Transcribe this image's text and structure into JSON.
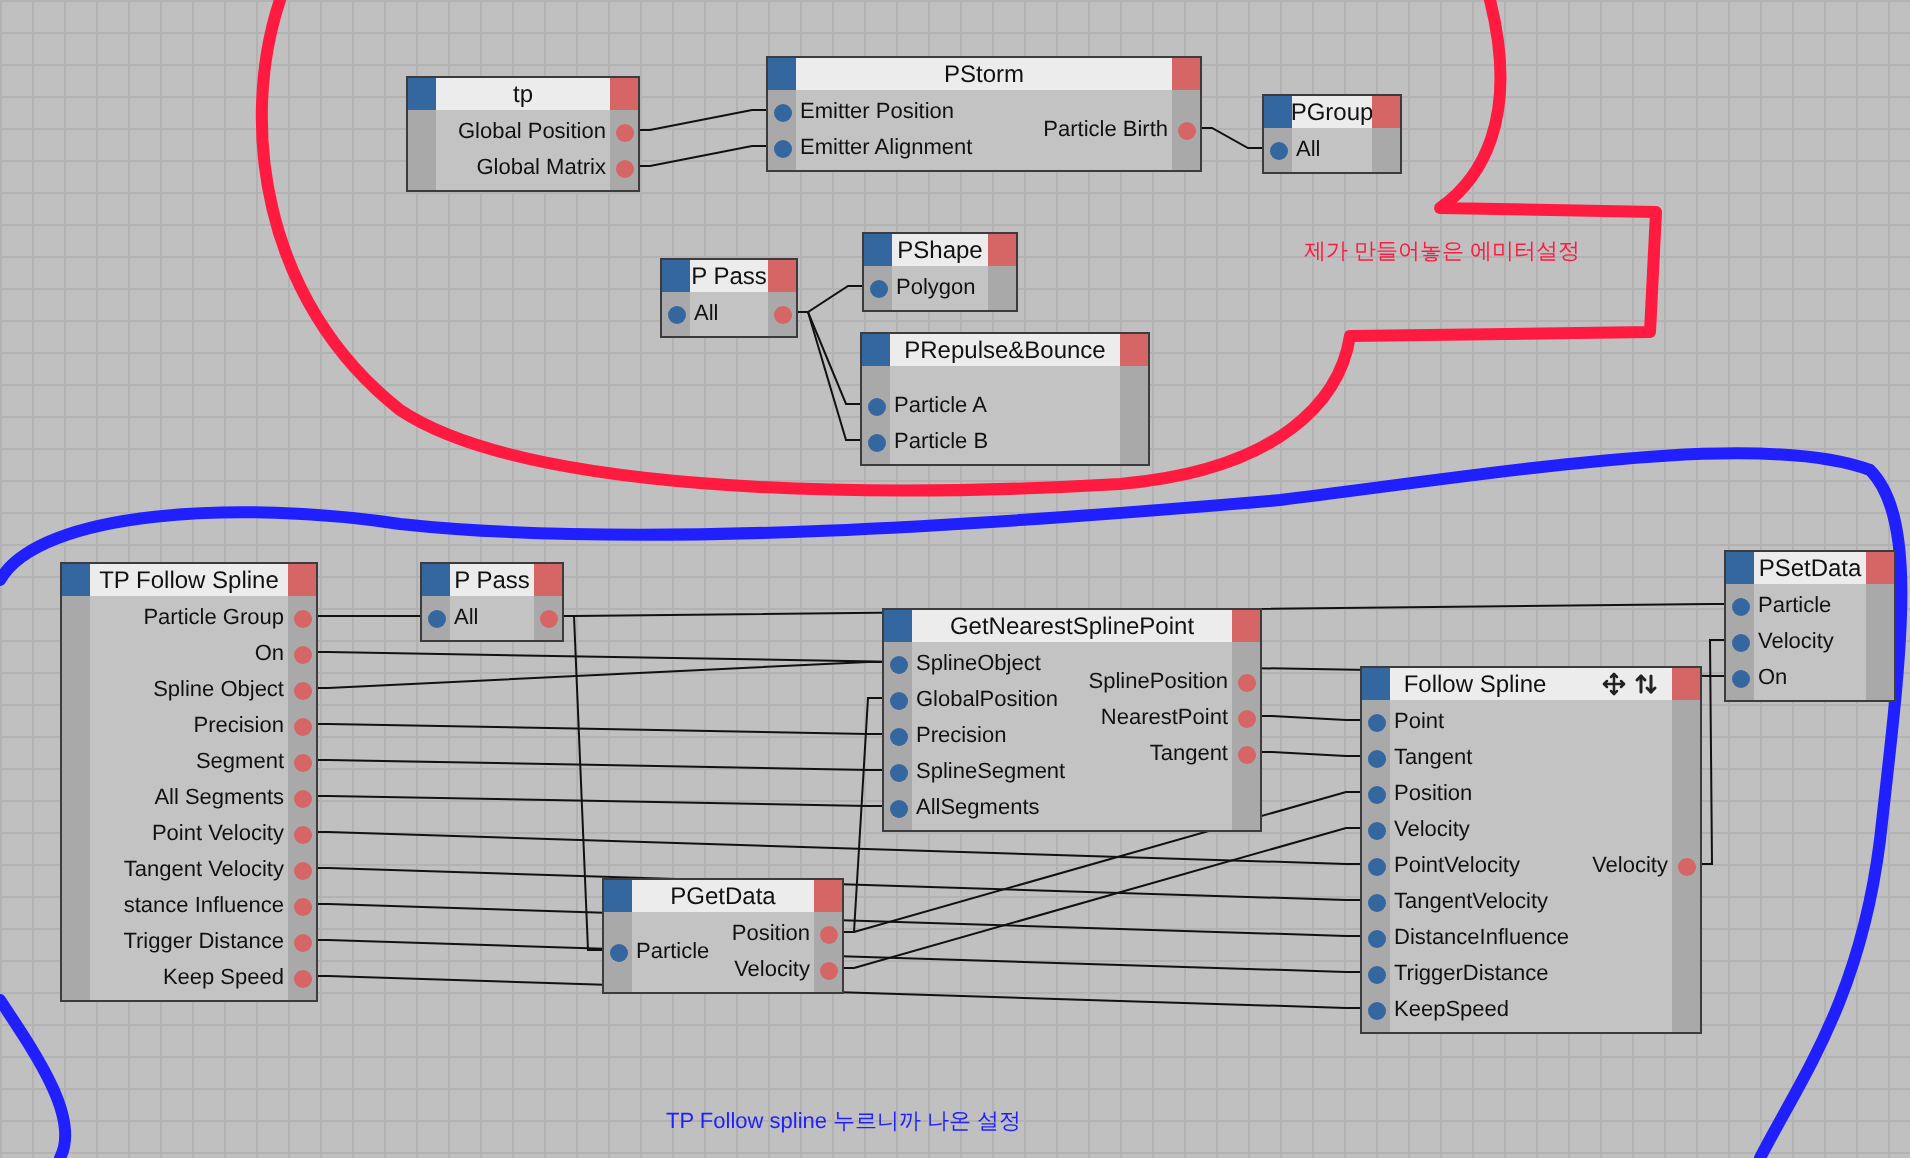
{
  "nodes": [
    {
      "title": "tp",
      "outputs": [
        "Global Position",
        "Global Matrix"
      ]
    },
    {
      "title": "PStorm",
      "inputs": [
        "Emitter Position",
        "Emitter Alignment"
      ],
      "outputs": [
        "Particle Birth"
      ]
    },
    {
      "title": "PGroup",
      "inputs": [
        "All"
      ],
      "passthrough": false
    },
    {
      "title": "P Pass",
      "inputs": [
        "All"
      ],
      "passthrough": true
    },
    {
      "title": "PShape",
      "inputs": [
        "Polygon"
      ]
    },
    {
      "title": "PRepulse&Bounce",
      "inputs": [
        "Particle A",
        "Particle B"
      ]
    },
    {
      "title": "TP Follow Spline",
      "outputs": [
        "Particle Group",
        "On",
        "Spline Object",
        "Precision",
        "Segment",
        "All Segments",
        "Point Velocity",
        "Tangent Velocity",
        "stance Influence",
        "Trigger Distance",
        "Keep Speed"
      ]
    },
    {
      "title": "P Pass",
      "inputs": [
        "All"
      ],
      "passthrough": true
    },
    {
      "title": "GetNearestSplinePoint",
      "inputs": [
        "SplineObject",
        "GlobalPosition",
        "Precision",
        "SplineSegment",
        "AllSegments"
      ],
      "outputs": [
        "SplinePosition",
        "NearestPoint",
        "Tangent"
      ]
    },
    {
      "title": "PGetData",
      "inputs": [
        "Particle"
      ],
      "outputs": [
        "Position",
        "Velocity"
      ]
    },
    {
      "title": "Follow Spline",
      "inputs": [
        "Point",
        "Tangent",
        "Position",
        "Velocity",
        "PointVelocity",
        "TangentVelocity",
        "DistanceInfluence",
        "TriggerDistance",
        "KeepSpeed"
      ],
      "outputs": [
        "Velocity"
      ],
      "toolbar": true
    },
    {
      "title": "PSetData",
      "inputs": [
        "Particle",
        "Velocity",
        "On"
      ]
    }
  ],
  "notes": [
    {
      "text": "제가 만들어놓은 에미터설정",
      "color": "#ff1a40"
    },
    {
      "text": "TP Follow spline 누르니까 나온 설정",
      "color": "#2020ff"
    }
  ]
}
